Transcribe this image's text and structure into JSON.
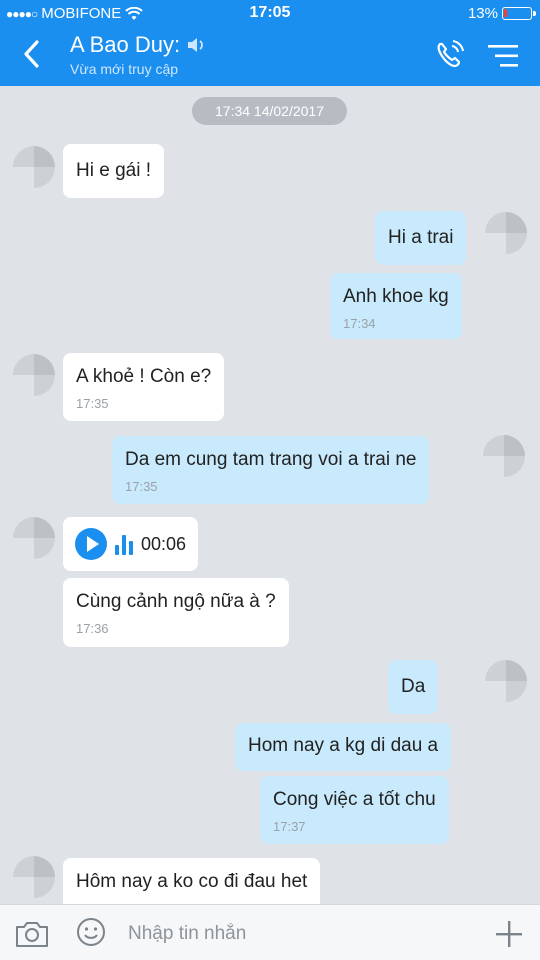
{
  "status": {
    "carrier": "MOBIFONE",
    "time": "17:05",
    "battery": "13%",
    "battery_level": 0.13
  },
  "header": {
    "name": "A Bao Duy:",
    "subtitle": "Vừa mới truy cập"
  },
  "chat": {
    "date": "17:34 14/02/2017",
    "messages": [
      {
        "side": "received",
        "text": "Hi e gái !",
        "time": ""
      },
      {
        "side": "sent",
        "text": "Hi a trai",
        "time": ""
      },
      {
        "side": "sent",
        "text": "Anh khoe kg",
        "time": "17:34"
      },
      {
        "side": "received",
        "text": "A khoẻ ! Còn e?",
        "time": "17:35"
      },
      {
        "side": "sent",
        "text": "Da em cung tam trang voi a trai ne",
        "time": "17:35"
      },
      {
        "side": "received",
        "type": "voice",
        "duration": "00:06"
      },
      {
        "side": "received",
        "text": "Cùng cảnh ngộ nữa à ?",
        "time": "17:36"
      },
      {
        "side": "sent",
        "text": "Da",
        "time": ""
      },
      {
        "side": "sent",
        "text": "Hom nay a kg di dau a",
        "time": ""
      },
      {
        "side": "sent",
        "text": "Cong việc a tốt chu",
        "time": "17:37"
      },
      {
        "side": "received",
        "text": "Hôm nay a ko co đi đau het",
        "time": ""
      }
    ]
  },
  "input": {
    "placeholder": "Nhập tin nhắn"
  },
  "icons": {
    "back": "chevron-left-icon",
    "speaker": "speaker-icon",
    "call": "phone-call-icon",
    "menu": "menu-icon",
    "camera": "camera-icon",
    "emoji": "smiley-icon",
    "add": "plus-icon"
  },
  "colors": {
    "header": "#1a8ff0",
    "sent_bubble": "#c8eafc",
    "received_bubble": "#ffffff",
    "chat_background": "#dfe3e8",
    "battery_low": "#ff3b30"
  }
}
